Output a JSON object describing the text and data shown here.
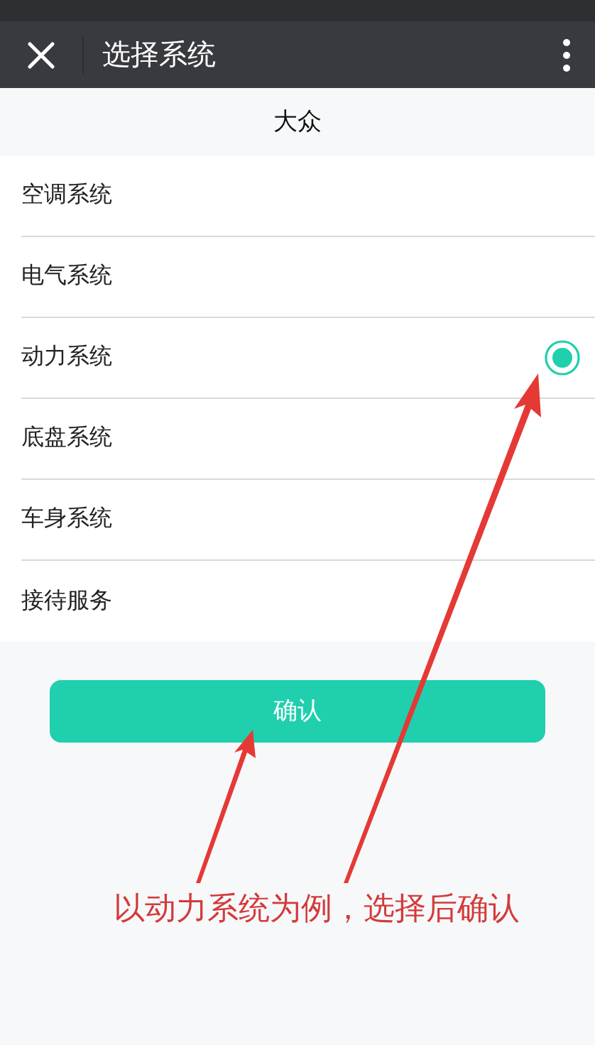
{
  "header": {
    "title": "选择系统"
  },
  "brand": "大众",
  "systems": [
    {
      "label": "空调系统",
      "selected": false
    },
    {
      "label": "电气系统",
      "selected": false
    },
    {
      "label": "动力系统",
      "selected": true
    },
    {
      "label": "底盘系统",
      "selected": false
    },
    {
      "label": "车身系统",
      "selected": false
    },
    {
      "label": "接待服务",
      "selected": false
    }
  ],
  "confirm_button": "确认",
  "annotation": "以动力系统为例，选择后确认"
}
